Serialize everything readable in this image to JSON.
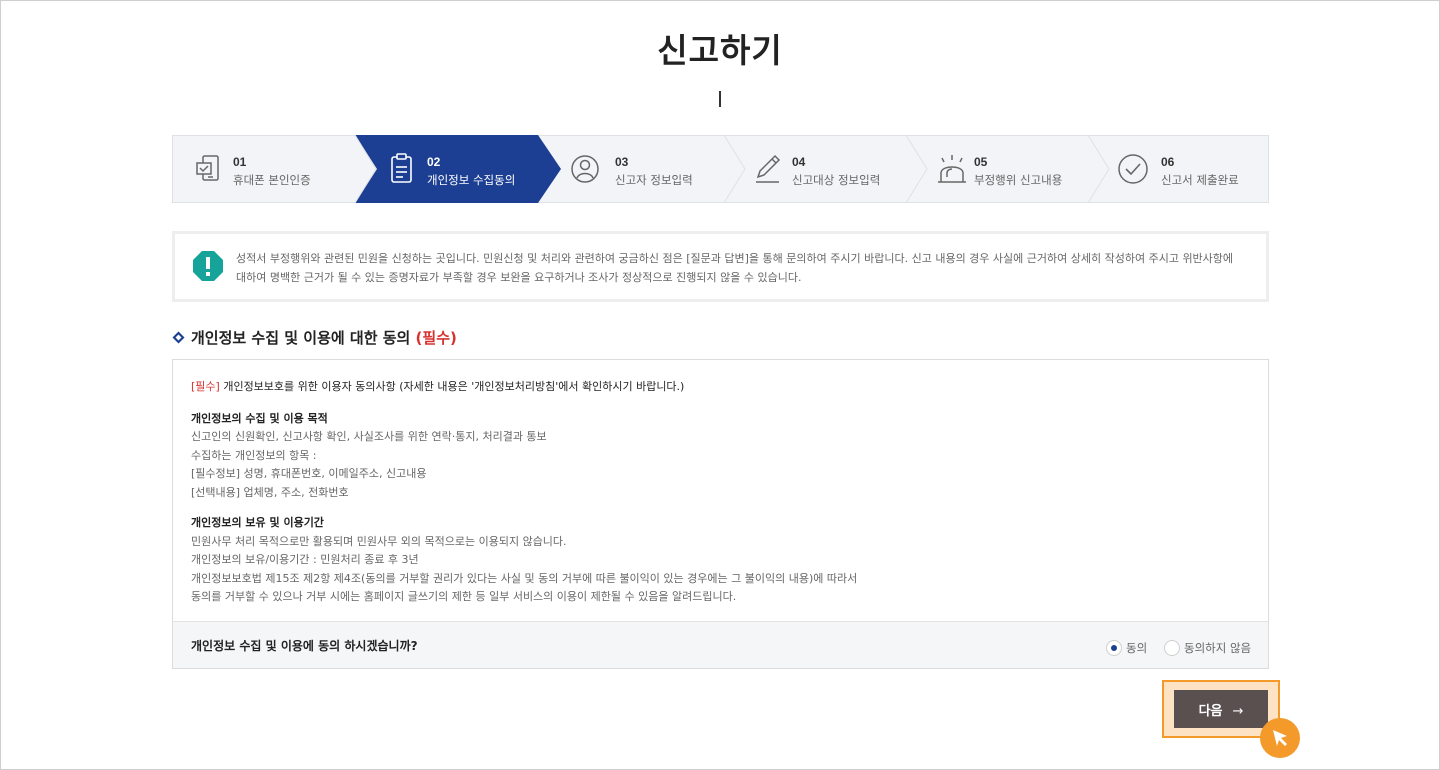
{
  "page": {
    "title": "신고하기"
  },
  "steps": [
    {
      "num": "01",
      "label": "휴대폰 본인인증",
      "icon": "phone-auth-icon"
    },
    {
      "num": "02",
      "label": "개인정보 수집동의",
      "icon": "clipboard-icon",
      "active": true
    },
    {
      "num": "03",
      "label": "신고자 정보입력",
      "icon": "user-icon"
    },
    {
      "num": "04",
      "label": "신고대상 정보입력",
      "icon": "pencil-icon"
    },
    {
      "num": "05",
      "label": "부정행위 신고내용",
      "icon": "alarm-light-icon"
    },
    {
      "num": "06",
      "label": "신고서 제출완료",
      "icon": "check-circle-icon"
    }
  ],
  "notice": {
    "line1": "성적서 부정행위와 관련된 민원을 신청하는 곳입니다. 민원신청 및 처리와 관련하여 궁금하신 점은 [질문과 답변]을 통해 문의하여 주시기 바랍니다. 신고 내용의 경우 사실에 근거하여 상세히 작성하여 주시고 위반사항에",
    "line2": "대하여 명백한 근거가 될 수 있는 증명자료가 부족할 경우 보완을 요구하거나 조사가 정상적으로 진행되지 않을 수 있습니다."
  },
  "section": {
    "heading": "개인정보 수집 및 이용에 대한 동의",
    "required": "(필수)"
  },
  "terms": {
    "lead_tag": "[필수]",
    "lead_text": " 개인정보보호를 위한 이용자 동의사항 (자세한 내용은 '개인정보처리방침'에서 확인하시기 바랍니다.)",
    "purpose_heading": "개인정보의 수집 및 이용 목적",
    "purpose_lines": [
      "신고인의 신원확인, 신고사항 확인, 사실조사를 위한 연락·통지, 처리결과 통보",
      "수집하는 개인정보의 항목 :",
      "[필수정보] 성명, 휴대폰번호, 이메일주소, 신고내용",
      "[선택내용] 업체명, 주소, 전화번호"
    ],
    "retention_heading": "개인정보의 보유 및 이용기간",
    "retention_lines": [
      "민원사무 처리 목적으로만 활용되며 민원사무 외의 목적으로는 이용되지 않습니다.",
      "개인정보의 보유/이용기간 : 민원처리 종료 후 3년",
      "개인정보보호법 제15조 제2항 제4조(동의를 거부할 권리가 있다는 사실 및 동의 거부에 따른 불이익이 있는 경우에는 그 불이익의 내용)에 따라서",
      "동의를 거부할 수 있으나 거부 시에는 홈페이지 글쓰기의 제한 등 일부 서비스의 이용이 제한될 수 있음을 알려드립니다."
    ]
  },
  "consent": {
    "question": "개인정보 수집 및 이용에 동의 하시겠습니까?",
    "agree_label": "동의",
    "disagree_label": "동의하지 않음",
    "selected": "agree"
  },
  "actions": {
    "next_label": "다음",
    "next_arrow": "→"
  },
  "colors": {
    "active_step": "#1c3f94",
    "required": "#d6322f",
    "next_button": "#5b5050",
    "highlight": "#f39a2b",
    "notice_icon": "#16a39a"
  }
}
